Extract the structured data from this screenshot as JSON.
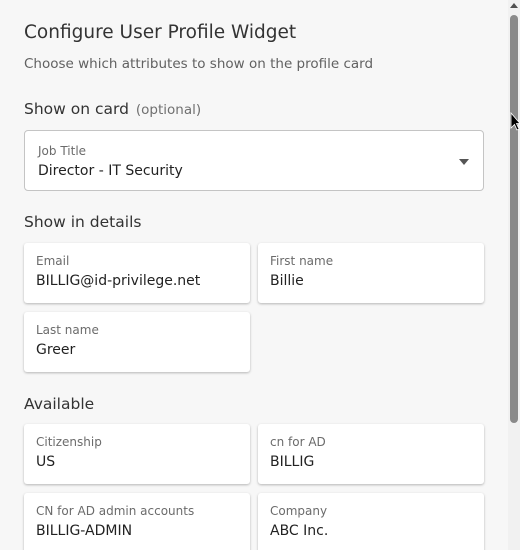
{
  "dialog": {
    "title": "Configure User Profile Widget",
    "subtitle": "Choose which attributes to show on the profile card"
  },
  "show_on_card": {
    "heading": "Show on card",
    "optional": "(optional)",
    "field": {
      "label": "Job Title",
      "value": "Director - IT Security"
    }
  },
  "show_in_details": {
    "heading": "Show in details",
    "fields": [
      {
        "label": "Email",
        "value": "BILLIG@id-privilege.net"
      },
      {
        "label": "First name",
        "value": "Billie"
      },
      {
        "label": "Last name",
        "value": "Greer"
      }
    ]
  },
  "available": {
    "heading": "Available",
    "fields": [
      {
        "label": "Citizenship",
        "value": "US"
      },
      {
        "label": "cn for AD",
        "value": "BILLIG"
      },
      {
        "label": "CN for AD admin accounts",
        "value": "BILLIG-ADMIN"
      },
      {
        "label": "Company",
        "value": "ABC Inc."
      }
    ]
  },
  "icons": {
    "select_caret": "caret-down-icon",
    "scroll_up": "scroll-up-arrow-icon",
    "cursor": "mouse-pointer-icon"
  }
}
